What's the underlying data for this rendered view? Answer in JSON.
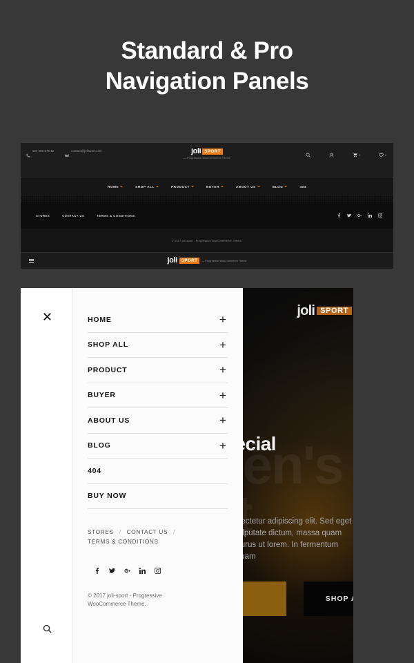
{
  "title": {
    "line1": "Standard & Pro",
    "line2": "Navigation Panels"
  },
  "desktop_mockup": {
    "topbar": {
      "phone": "020 986 579 42",
      "email": "contact@jolisport.com",
      "phone_icon": "phone-icon",
      "email_icon": "envelope-icon"
    },
    "logo": {
      "name": "joli",
      "badge": "SPORT",
      "tagline": "— Progressive WooCommerce Theme"
    },
    "header_icons": [
      {
        "name": "search-icon",
        "count": ""
      },
      {
        "name": "user-icon",
        "count": ""
      },
      {
        "name": "cart-icon",
        "count": "0"
      },
      {
        "name": "heart-icon",
        "count": "0"
      }
    ],
    "nav": [
      {
        "label": "HOME",
        "has_dropdown": true
      },
      {
        "label": "SHOP ALL",
        "has_dropdown": true
      },
      {
        "label": "PRODUCT",
        "has_dropdown": true
      },
      {
        "label": "BUYER",
        "has_dropdown": true
      },
      {
        "label": "ABOUT US",
        "has_dropdown": true
      },
      {
        "label": "BLOG",
        "has_dropdown": true
      },
      {
        "label": "404",
        "has_dropdown": false
      }
    ],
    "footer_links": [
      "STORES",
      "CONTACT US",
      "TERMS & CONDITIONS"
    ],
    "social": [
      "facebook-icon",
      "twitter-icon",
      "google-plus-icon",
      "linkedin-icon",
      "instagram-icon"
    ],
    "copyright": "© 2017 joli-sport - Progressive WooCommerce Theme.",
    "bottom_bar": {
      "menu_icon": "hamburger-icon",
      "tagline": "— Progressive WooCommerce Theme"
    }
  },
  "mobile_panel": {
    "close_icon": "close-icon",
    "search_icon": "search-icon",
    "menu": [
      {
        "label": "HOME",
        "expander": "+"
      },
      {
        "label": "SHOP ALL",
        "expander": "+"
      },
      {
        "label": "PRODUCT",
        "expander": "+"
      },
      {
        "label": "BUYER",
        "expander": "+"
      },
      {
        "label": "ABOUT US",
        "expander": "+"
      },
      {
        "label": "BLOG",
        "expander": "+"
      },
      {
        "label": "404",
        "expander": ""
      },
      {
        "label": "BUY NOW",
        "expander": ""
      }
    ],
    "links": {
      "stores": "STORES",
      "contact": "CONTACT US",
      "terms": "TERMS & CONDITIONS",
      "separator": "/"
    },
    "social": [
      "facebook-icon",
      "twitter-icon",
      "google-plus-icon",
      "linkedin-icon",
      "instagram-icon"
    ],
    "copyright": "© 2017 joli-sport - Progressive WooCommerce Theme."
  },
  "hero": {
    "ghost_line1": "women's",
    "ghost_line2": "sport",
    "heading": "Made for special",
    "paragraph": "Lorem ipsum dolor sit amet, consectetur adipiscing elit. Sed eget nisl id augue euismod, quam a vulputate dictum, massa quam dapibus leo, eget vulputate orci purus ut lorem. In fermentum sapien ut pellentesque aliquam quam",
    "logo_name": "joli",
    "logo_badge": "SPORT",
    "button_primary": "",
    "button_secondary": "SHOP ALL",
    "arrow_icon": "arrow-right-icon"
  },
  "colors": {
    "page_bg": "#383838",
    "accent_orange": "#f07c16",
    "panel_bg": "#fbfbfb",
    "dark": "#161616"
  }
}
